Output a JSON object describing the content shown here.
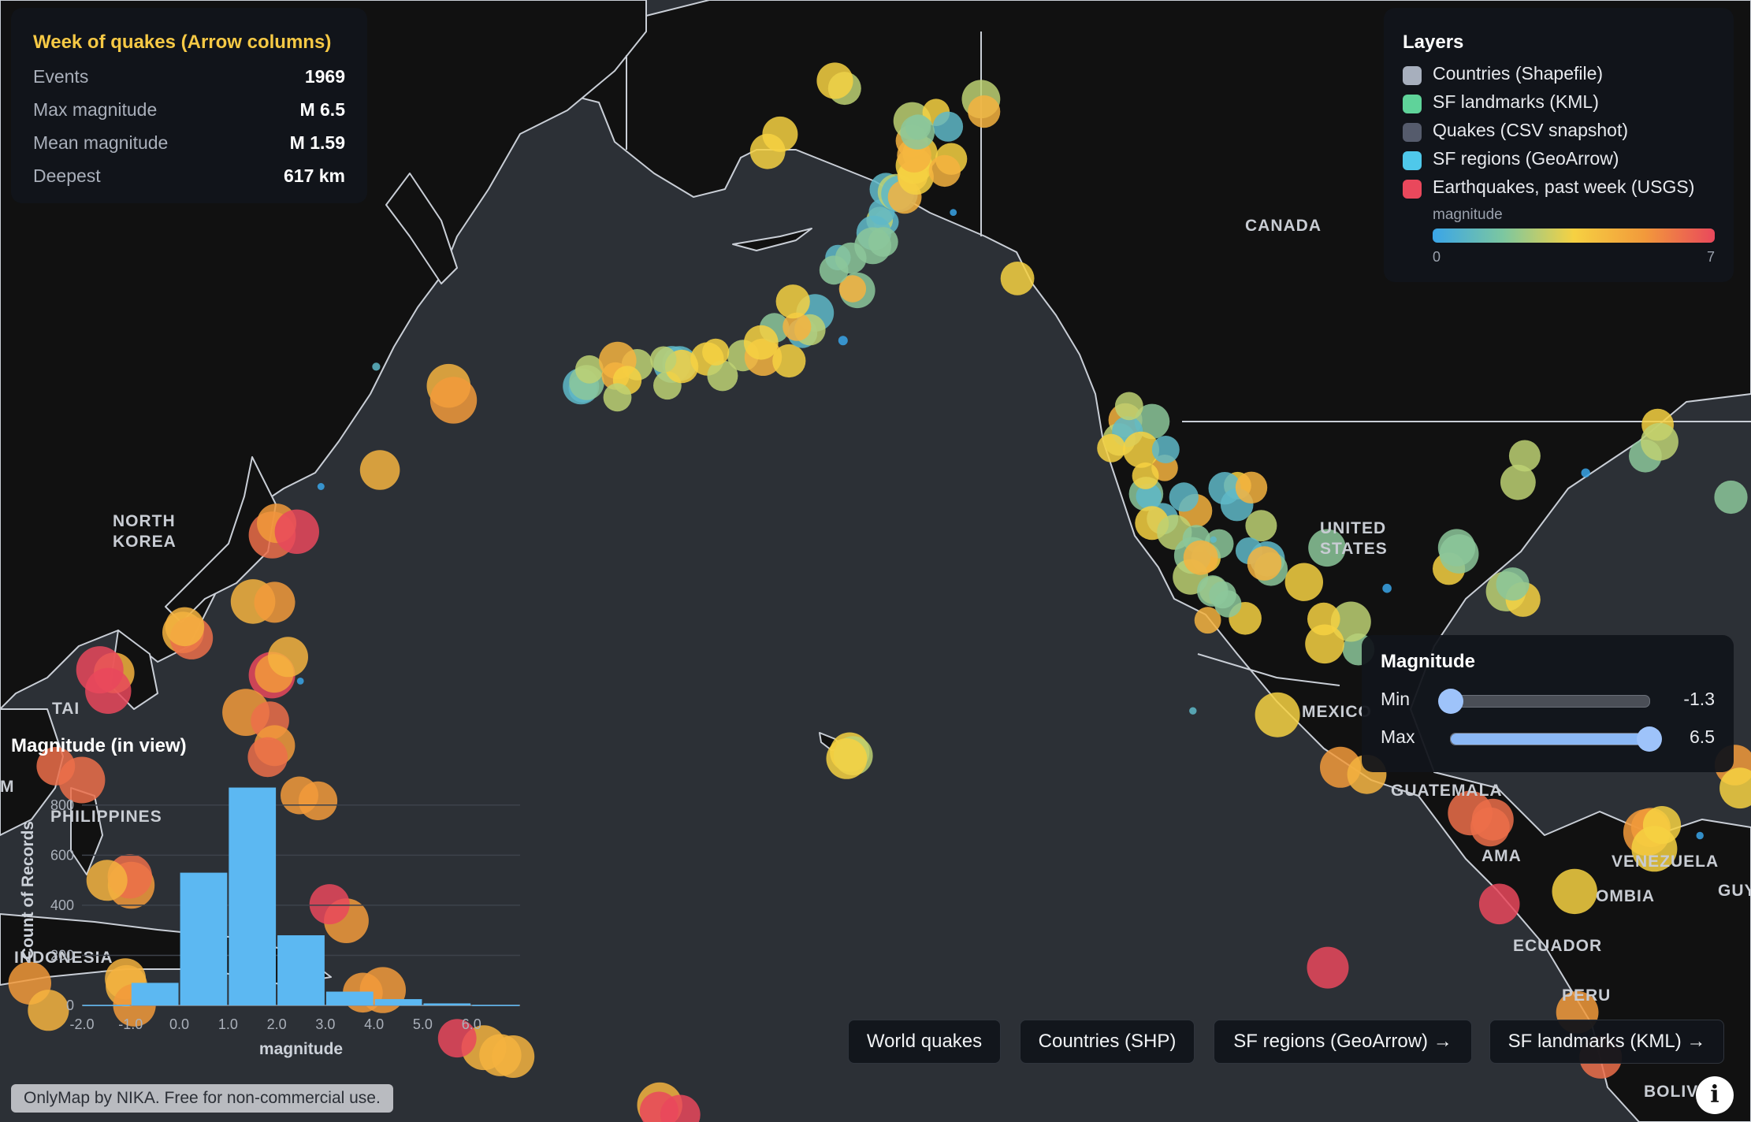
{
  "stats": {
    "title": "Week of quakes (Arrow columns)",
    "rows": [
      {
        "label": "Events",
        "value": "1969"
      },
      {
        "label": "Max magnitude",
        "value": "M 6.5"
      },
      {
        "label": "Mean magnitude",
        "value": "M 1.59"
      },
      {
        "label": "Deepest",
        "value": "617 km"
      }
    ]
  },
  "layers": {
    "title": "Layers",
    "items": [
      {
        "label": "Countries (Shapefile)",
        "color": "#a7afbd"
      },
      {
        "label": "SF landmarks (KML)",
        "color": "#5fd39a"
      },
      {
        "label": "Quakes (CSV snapshot)",
        "color": "#555b6c"
      },
      {
        "label": "SF regions (GeoArrow)",
        "color": "#4fc8ea"
      },
      {
        "label": "Earthquakes, past week (USGS)",
        "color": "#e9485c"
      }
    ],
    "colorbar": {
      "label": "magnitude",
      "min": "0",
      "max": "7"
    }
  },
  "filter": {
    "title": "Magnitude",
    "min_label": "Min",
    "max_label": "Max",
    "min_value": "-1.3",
    "max_value": "6.5",
    "range": [
      -1.3,
      6.5
    ]
  },
  "buttons": [
    {
      "label": "World quakes"
    },
    {
      "label": "Countries (SHP)"
    },
    {
      "label": "SF regions (GeoArrow) →"
    },
    {
      "label": "SF landmarks (KML) →"
    }
  ],
  "attribution": "OnlyMap by NIKA. Free for non-commercial use.",
  "info_icon": "i",
  "map_labels": [
    "CANADA",
    "UNITED",
    "STATES",
    "NORTH",
    "KOREA",
    "MEXICO",
    "GUATEMALA",
    "VENEZUELA",
    "OMBIA",
    "ECUADOR",
    "PERU",
    "BOLIVIA",
    "PHILIPPINES",
    "INDONESIA",
    "TAI",
    "AMA",
    "GUYAN",
    "M"
  ],
  "chart_data": {
    "type": "bar",
    "title": "Magnitude (in view)",
    "xlabel": "magnitude",
    "ylabel": "Count of Records",
    "tick_labels": [
      "-2.0",
      "-1.0",
      "0.0",
      "1.0",
      "2.0",
      "3.0",
      "4.0",
      "5.0",
      "6.0"
    ],
    "y_ticks": [
      "0",
      "200",
      "400",
      "600",
      "800"
    ],
    "bin_edges": [
      -2,
      -1,
      0,
      1,
      2,
      3,
      4,
      5,
      6,
      7
    ],
    "values": [
      2,
      90,
      530,
      870,
      280,
      55,
      25,
      8,
      2
    ],
    "ylim": [
      0,
      900
    ],
    "xlim": [
      -2,
      7
    ],
    "color": "#5cb8f2"
  },
  "colors": {
    "ocean": "#2c3036",
    "land": "#111111",
    "border": "#c9ced6",
    "accent": "#f6c945"
  }
}
